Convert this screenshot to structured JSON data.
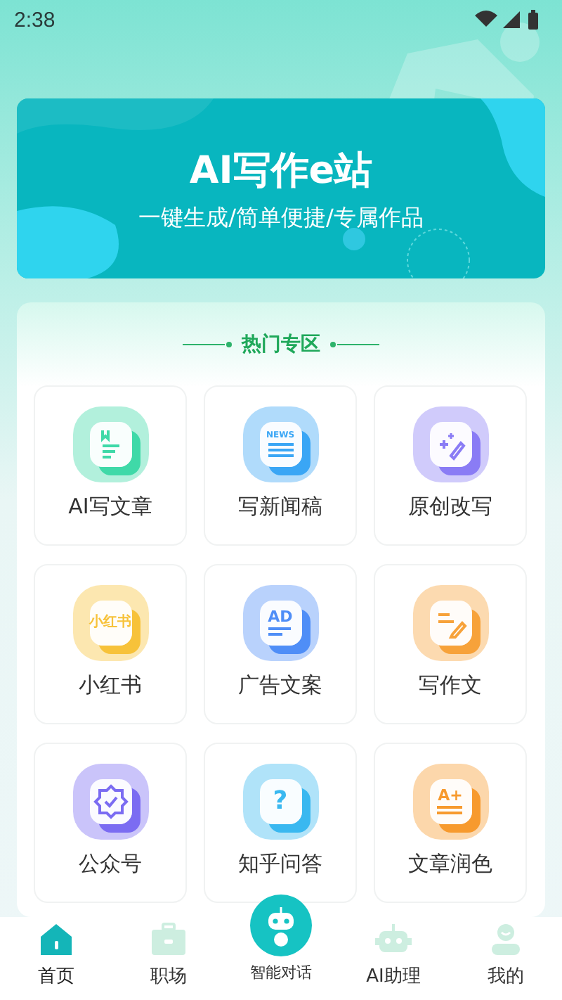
{
  "status_bar": {
    "time": "2:38"
  },
  "banner": {
    "title": "AI写作e站",
    "subtitle": "一键生成/简单便捷/专属作品"
  },
  "section": {
    "title": "热门专区",
    "items": [
      {
        "label": "AI写文章",
        "kind": "doc",
        "color": "#3fd9a8"
      },
      {
        "label": "写新闻稿",
        "kind": "news",
        "color": "#3aa6f5",
        "icon_text": "NEWS"
      },
      {
        "label": "原创改写",
        "kind": "sparkle",
        "color": "#8a7cf5"
      },
      {
        "label": "小红书",
        "kind": "tag",
        "color": "#f7c23a",
        "icon_text": "小红书"
      },
      {
        "label": "广告文案",
        "kind": "ad",
        "color": "#4f8ef7",
        "icon_text": "AD"
      },
      {
        "label": "写作文",
        "kind": "pen",
        "color": "#f7a23a"
      },
      {
        "label": "公众号",
        "kind": "verify",
        "color": "#7b6cf2"
      },
      {
        "label": "知乎问答",
        "kind": "question",
        "color": "#3ab8f0",
        "icon_text": "?"
      },
      {
        "label": "文章润色",
        "kind": "grade",
        "color": "#f79a2e",
        "icon_text": "A+"
      }
    ]
  },
  "nav": [
    {
      "label": "首页",
      "kind": "home",
      "selected": true
    },
    {
      "label": "职场",
      "kind": "briefcase",
      "selected": false
    },
    {
      "label": "智能对话",
      "kind": "center",
      "selected": false
    },
    {
      "label": "AI助理",
      "kind": "robot",
      "selected": false
    },
    {
      "label": "我的",
      "kind": "person",
      "selected": false
    }
  ]
}
